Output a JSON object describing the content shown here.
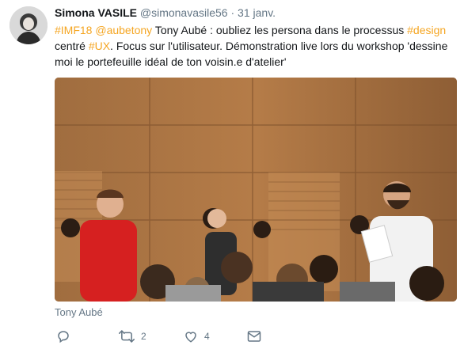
{
  "author": {
    "name": "Simona VASILE",
    "handle": "@simonavasile56",
    "separator": "·",
    "date": "31 janv."
  },
  "tweet": {
    "segments": [
      {
        "text": "#IMF18",
        "highlight": true
      },
      {
        "text": " ",
        "highlight": false
      },
      {
        "text": "@aubetony",
        "highlight": true
      },
      {
        "text": " Tony Aubé : oubliez les persona dans le processus ",
        "highlight": false
      },
      {
        "text": "#design",
        "highlight": true
      },
      {
        "text": " centré ",
        "highlight": false
      },
      {
        "text": "#UX",
        "highlight": true
      },
      {
        "text": ". Focus sur l'utilisateur. Démonstration live lors du workshop 'dessine moi le portefeuille idéal de ton voisin.e d'atelier'",
        "highlight": false
      }
    ]
  },
  "media": {
    "caption": "Tony Aubé"
  },
  "actions": {
    "reply": {
      "icon": "reply-icon",
      "count": ""
    },
    "retweet": {
      "icon": "retweet-icon",
      "count": "2"
    },
    "like": {
      "icon": "heart-icon",
      "count": "4"
    },
    "message": {
      "icon": "envelope-icon",
      "count": ""
    }
  },
  "colors": {
    "accent": "#f5a623",
    "muted": "#657786",
    "text": "#14171a"
  }
}
